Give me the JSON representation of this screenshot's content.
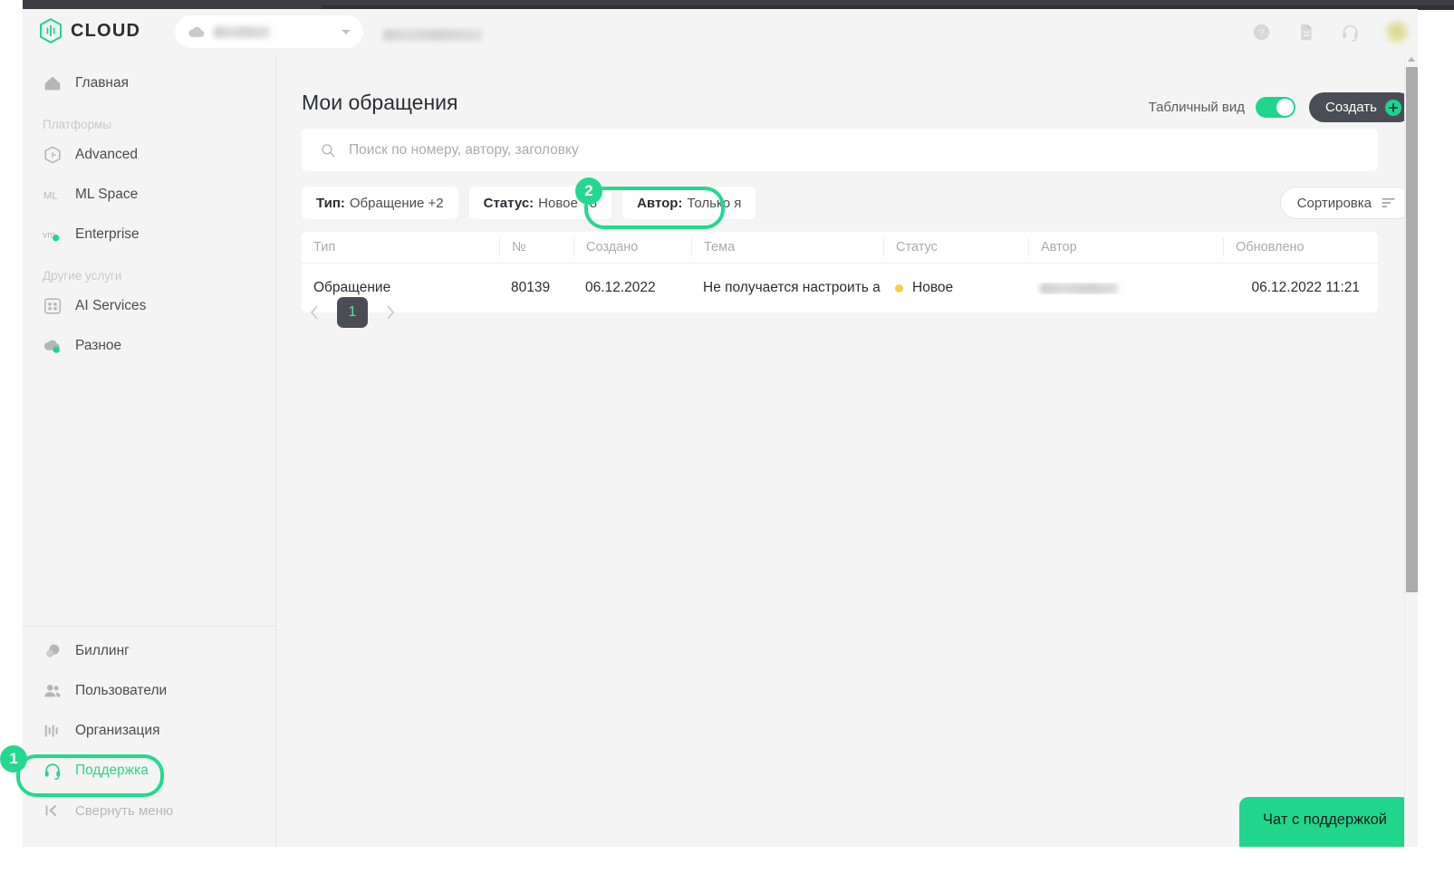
{
  "brand": {
    "name": "CLOUD",
    "accent": "#1fd68c",
    "dark": "#4a4d55"
  },
  "topbar": {
    "project_selector_placeholder": "",
    "icons": [
      {
        "name": "help-icon",
        "glyph": "?"
      },
      {
        "name": "docs-icon",
        "glyph": "doc"
      },
      {
        "name": "support-headset-icon",
        "glyph": "headset"
      },
      {
        "name": "user-avatar",
        "glyph": "avatar"
      }
    ]
  },
  "sidebar": {
    "top_items": [
      {
        "label": "Главная",
        "icon": "home-icon",
        "active": false
      }
    ],
    "groups": [
      {
        "title": "Платформы",
        "items": [
          {
            "label": "Advanced",
            "icon": "cube-icon",
            "active": false
          },
          {
            "label": "ML Space",
            "icon": "ml-icon",
            "active": false
          },
          {
            "label": "Enterprise",
            "icon": "vm-icon",
            "active": false
          }
        ]
      },
      {
        "title": "Другие услуги",
        "items": [
          {
            "label": "AI Services",
            "icon": "grid-icon",
            "active": false
          },
          {
            "label": "Разное",
            "icon": "misc-cloud-icon",
            "active": false
          }
        ]
      }
    ],
    "bottom_items": [
      {
        "label": "Биллинг",
        "icon": "billing-icon",
        "active": false
      },
      {
        "label": "Пользователи",
        "icon": "users-icon",
        "active": false
      },
      {
        "label": "Организация",
        "icon": "organization-icon",
        "active": false
      },
      {
        "label": "Поддержка",
        "icon": "support-headset-icon",
        "active": true
      }
    ],
    "collapse": {
      "label": "Свернуть меню",
      "icon": "collapse-left-icon"
    }
  },
  "main": {
    "title": "Мои обращения",
    "view_toggle": {
      "label": "Табличный вид",
      "enabled": true
    },
    "create_button": {
      "label": "Создать",
      "icon": "plus-circle-icon"
    },
    "search": {
      "value": "",
      "placeholder": "Поиск по номеру, автору, заголовку",
      "icon": "search-icon"
    },
    "filters": [
      {
        "key": "Тип:",
        "value": "Обращение +2",
        "highlighted": false
      },
      {
        "key": "Статус:",
        "value": "Новое +8",
        "highlighted": false
      },
      {
        "key": "Автор:",
        "value": "Только я",
        "highlighted": true
      }
    ],
    "sort_button": {
      "label": "Сортировка",
      "icon": "sort-icon"
    },
    "table": {
      "columns": [
        "Тип",
        "№",
        "Создано",
        "Тема",
        "Статус",
        "Автор",
        "Обновлено"
      ],
      "rows": [
        {
          "type": "Обращение",
          "number": "80139",
          "created": "06.12.2022",
          "topic": "Не получается настроить а",
          "status": "Новое",
          "status_color": "#f2cf4a",
          "author": "",
          "updated": "06.12.2022 11:21"
        }
      ]
    },
    "pagination": {
      "prev": "‹",
      "next": "›",
      "current_page": "1"
    },
    "chat_button": {
      "label": "Чат с поддержкой"
    }
  },
  "annotations": [
    {
      "id": "1",
      "target": "sidebar-item-support"
    },
    {
      "id": "2",
      "target": "filter-chip-author"
    }
  ]
}
